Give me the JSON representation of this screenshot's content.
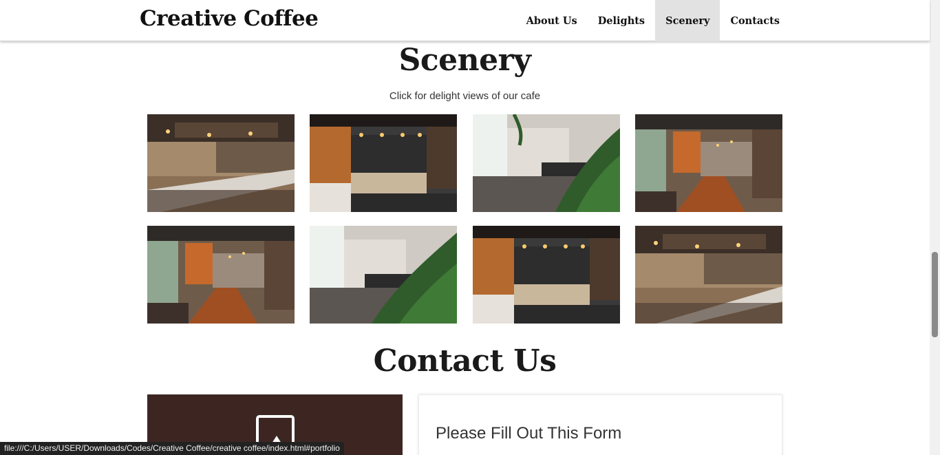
{
  "header": {
    "brand": "Creative Coffee",
    "nav": [
      {
        "label": "About Us",
        "active": false
      },
      {
        "label": "Delights",
        "active": false
      },
      {
        "label": "Scenery",
        "active": true
      },
      {
        "label": "Contacts",
        "active": false
      }
    ]
  },
  "scenery": {
    "title": "Scenery",
    "subtitle": "Click for delight views of our cafe"
  },
  "contact": {
    "title": "Contact Us",
    "form_title": "Please Fill Out This Form",
    "card_color": "#3d2622"
  },
  "status_bar": {
    "url": "file:///C:/Users/USER/Downloads/Codes/Creative Coffee/creative coffee/index.html#portfolio"
  }
}
